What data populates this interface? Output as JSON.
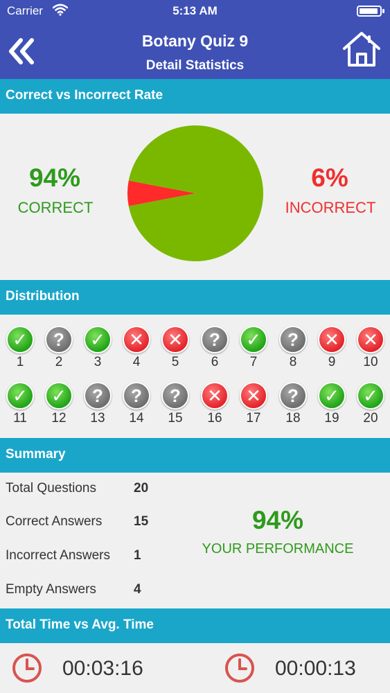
{
  "status_bar": {
    "carrier": "Carrier",
    "time": "5:13 AM"
  },
  "header": {
    "title": "Botany Quiz 9",
    "subtitle": "Detail Statistics"
  },
  "rate_section": {
    "heading": "Correct vs Incorrect Rate",
    "correct_pct": "94%",
    "correct_label": "CORRECT",
    "incorrect_pct": "6%",
    "incorrect_label": "INCORRECT"
  },
  "chart_data": {
    "type": "pie",
    "categories": [
      "Correct",
      "Incorrect"
    ],
    "values": [
      94,
      6
    ],
    "colors": [
      "#7ab800",
      "#ff2a2a"
    ]
  },
  "distribution": {
    "heading": "Distribution",
    "questions": [
      {
        "num": "1",
        "status": "correct"
      },
      {
        "num": "2",
        "status": "empty"
      },
      {
        "num": "3",
        "status": "correct"
      },
      {
        "num": "4",
        "status": "incorrect"
      },
      {
        "num": "5",
        "status": "incorrect"
      },
      {
        "num": "6",
        "status": "empty"
      },
      {
        "num": "7",
        "status": "correct"
      },
      {
        "num": "8",
        "status": "empty"
      },
      {
        "num": "9",
        "status": "incorrect"
      },
      {
        "num": "10",
        "status": "incorrect"
      },
      {
        "num": "11",
        "status": "correct"
      },
      {
        "num": "12",
        "status": "correct"
      },
      {
        "num": "13",
        "status": "empty"
      },
      {
        "num": "14",
        "status": "empty"
      },
      {
        "num": "15",
        "status": "empty"
      },
      {
        "num": "16",
        "status": "incorrect"
      },
      {
        "num": "17",
        "status": "incorrect"
      },
      {
        "num": "18",
        "status": "empty"
      },
      {
        "num": "19",
        "status": "correct"
      },
      {
        "num": "20",
        "status": "correct"
      }
    ]
  },
  "summary": {
    "heading": "Summary",
    "rows": [
      {
        "label": "Total Questions",
        "value": "20"
      },
      {
        "label": "Correct Answers",
        "value": "15"
      },
      {
        "label": "Incorrect Answers",
        "value": "1"
      },
      {
        "label": "Empty Answers",
        "value": "4"
      }
    ],
    "performance_pct": "94%",
    "performance_label": "YOUR PERFORMANCE"
  },
  "time": {
    "heading": "Total Time vs Avg. Time",
    "total": "00:03:16",
    "average": "00:00:13"
  },
  "icons": {
    "back": "double-chevron-left-icon",
    "home": "home-icon",
    "correct": "checkmark-icon",
    "incorrect": "x-mark-icon",
    "empty": "question-mark-icon",
    "clock": "clock-icon"
  },
  "colors": {
    "header": "#3f51b5",
    "section": "#1aa6c9",
    "correct": "#2e9a1c",
    "incorrect": "#ef2f2f"
  }
}
